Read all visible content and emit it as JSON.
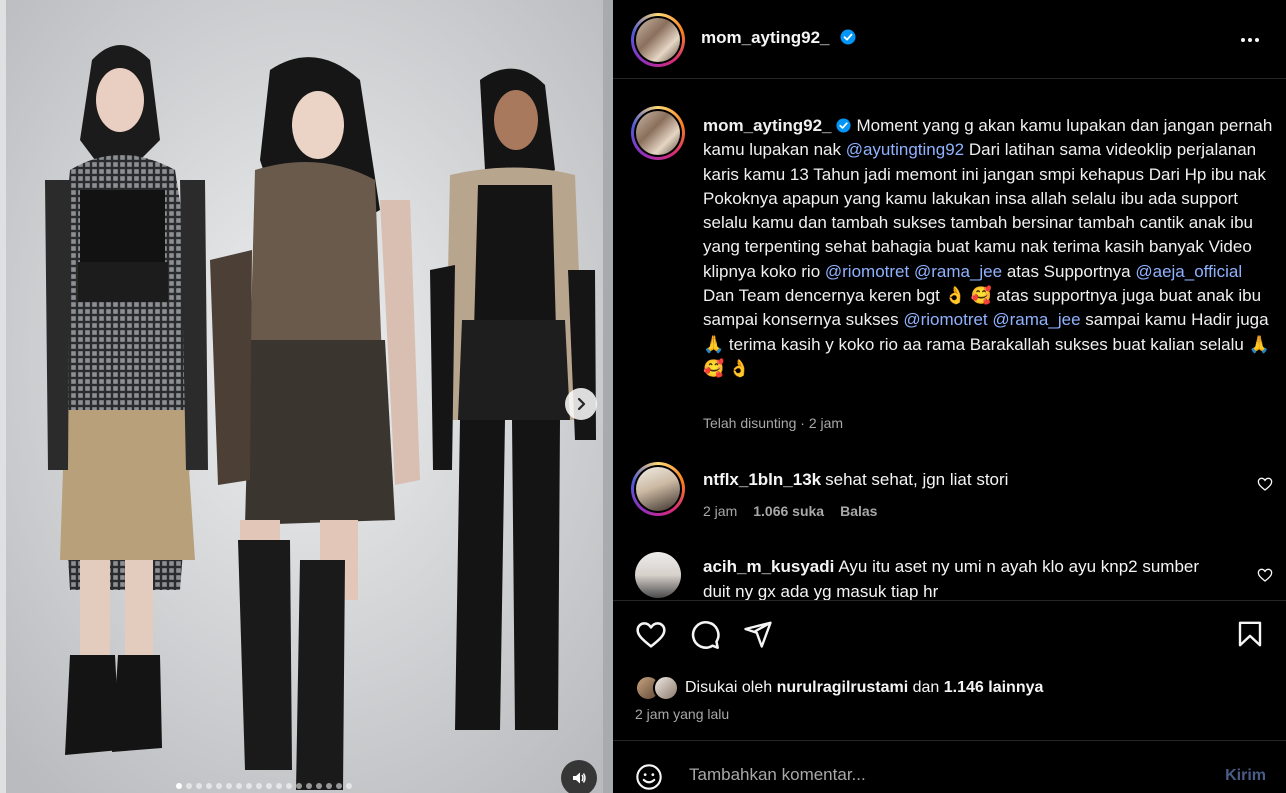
{
  "post": {
    "author": "mom_ayting92_",
    "caption_parts": [
      {
        "t": "Moment yang g akan kamu lupakan dan jangan pernah kamu lupakan nak ",
        "m": false
      },
      {
        "t": "@ayutingting92",
        "m": true
      },
      {
        "t": " Dari latihan sama videoklip perjalanan karis kamu 13 Tahun jadi memont ini jangan smpi kehapus Dari Hp ibu nak Pokoknya apapun yang kamu lakukan insa allah selalu ibu ada support selalu kamu dan tambah sukses tambah bersinar tambah cantik anak ibu yang terpenting sehat bahagia buat kamu nak terima kasih banyak Video klipnya koko rio ",
        "m": false
      },
      {
        "t": "@riomotret",
        "m": true
      },
      {
        "t": " ",
        "m": false
      },
      {
        "t": "@rama_jee",
        "m": true
      },
      {
        "t": " atas Supportnya ",
        "m": false
      },
      {
        "t": "@aeja_official",
        "m": true
      },
      {
        "t": " Dan Team dencernya keren bgt 👌 🥰  atas supportnya juga buat anak ibu sampai konsernya sukses ",
        "m": false
      },
      {
        "t": "@riomotret",
        "m": true
      },
      {
        "t": " ",
        "m": false
      },
      {
        "t": "@rama_jee",
        "m": true
      },
      {
        "t": " sampai kamu Hadir juga 🙏 terima kasih y koko rio aa rama Barakallah sukses buat kalian selalu 🙏🥰 👌",
        "m": false
      }
    ],
    "edited_meta": "Telah disunting · 2 jam"
  },
  "comments": [
    {
      "user": "ntflx_1bln_13k",
      "text": "sehat sehat, jgn liat stori",
      "time": "2 jam",
      "likes": "1.066 suka",
      "reply": "Balas"
    },
    {
      "user": "acih_m_kusyadi",
      "text": "Ayu itu aset ny umi n ayah klo ayu knp2 sumber duit ny gx ada yg masuk tiap hr",
      "time": "",
      "likes": "",
      "reply": ""
    }
  ],
  "likes_line": {
    "prefix": "Disukai oleh ",
    "user": "nurulragilrustami",
    "middle": " dan ",
    "count": "1.146 lainnya"
  },
  "time_ago": "2 jam yang lalu",
  "comment_box": {
    "placeholder": "Tambahkan komentar...",
    "post_label": "Kirim"
  },
  "carousel": {
    "slide_count": 18,
    "active_index": 0
  },
  "icons": {
    "verified": "verified-badge-icon",
    "more": "more-options-icon",
    "like": "heart-icon",
    "comment": "comment-icon",
    "share": "share-icon",
    "save": "bookmark-icon",
    "emoji": "emoji-icon",
    "next": "chevron-right-icon",
    "sound": "speaker-icon"
  },
  "colors": {
    "mention": "#8fb2ff",
    "verified": "#0095f6",
    "background": "#000000"
  }
}
